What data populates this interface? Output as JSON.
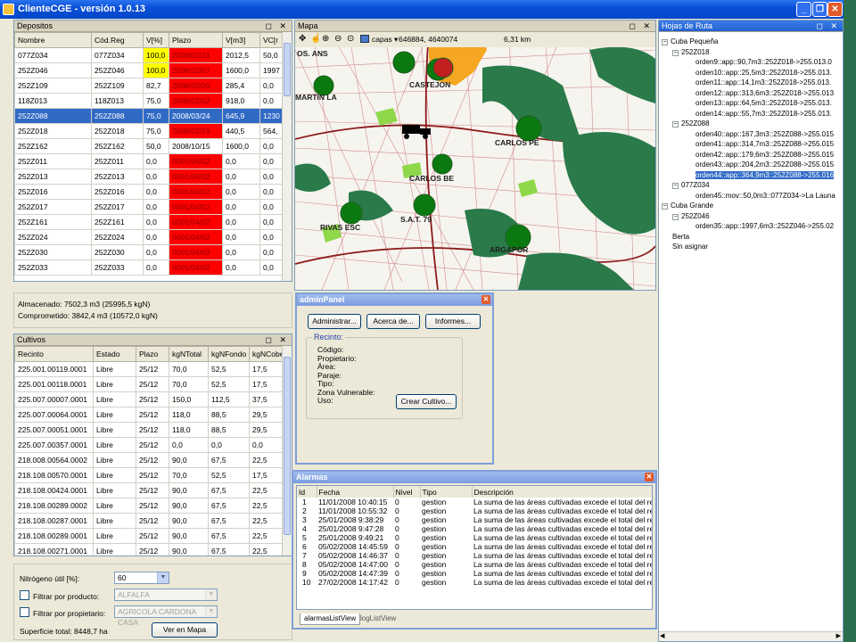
{
  "window": {
    "title": "ClienteCGE - versión 1.0.13",
    "controls": [
      "_",
      "❐",
      "✕"
    ]
  },
  "panel_buttons": "◻ ✕",
  "depositos": {
    "title": "Depositos",
    "columns": [
      "Nombre",
      "Cód.Reg",
      "V[%]",
      "Plazo",
      "V[m3]",
      "VC[r"
    ],
    "rows": [
      [
        "077Z034",
        "077Z034",
        "100,0",
        "2008/02/21",
        "2012,5",
        "50,0"
      ],
      [
        "252Z046",
        "252Z046",
        "100,0",
        "2008/02/07",
        "1600,0",
        "1997"
      ],
      [
        "252Z109",
        "252Z109",
        "82,7",
        "2008/03/20",
        "285,4",
        "0,0"
      ],
      [
        "118Z013",
        "118Z013",
        "75,0",
        "2008/02/02",
        "918,0",
        "0,0"
      ],
      [
        "252Z088",
        "252Z088",
        "75,0",
        "2008/03/24",
        "645,9",
        "1230"
      ],
      [
        "252Z018",
        "252Z018",
        "75,0",
        "2008/02/16",
        "440,5",
        "564,"
      ],
      [
        "252Z162",
        "252Z162",
        "50,0",
        "2008/10/15",
        "1600,0",
        "0,0"
      ],
      [
        "252Z011",
        "252Z011",
        "0,0",
        "0001/04/02",
        "0,0",
        "0,0"
      ],
      [
        "252Z013",
        "252Z013",
        "0,0",
        "0001/04/02",
        "0,0",
        "0,0"
      ],
      [
        "252Z016",
        "252Z016",
        "0,0",
        "0001/04/02",
        "0,0",
        "0,0"
      ],
      [
        "252Z017",
        "252Z017",
        "0,0",
        "0001/04/02",
        "0,0",
        "0,0"
      ],
      [
        "252Z161",
        "252Z161",
        "0,0",
        "0001/04/02",
        "0,0",
        "0,0"
      ],
      [
        "252Z024",
        "252Z024",
        "0,0",
        "0001/04/02",
        "0,0",
        "0,0"
      ],
      [
        "252Z030",
        "252Z030",
        "0,0",
        "0001/04/02",
        "0,0",
        "0,0"
      ],
      [
        "252Z033",
        "252Z033",
        "0,0",
        "0001/04/02",
        "0,0",
        "0,0"
      ]
    ],
    "status_colors": {
      "full": "#ffff00",
      "expired": "#ff0000",
      "selected": "#316ac5"
    },
    "almacenado": "Almacenado: 7502,3 m3 (25995,5 kgN)",
    "comprometido": "Comprometido: 3842,4 m3 (10572,0 kgN)"
  },
  "cultivos": {
    "title": "Cultivos",
    "columns": [
      "Recinto",
      "Estado",
      "Plazo",
      "kgNTotal",
      "kgNFondo",
      "kgNCober"
    ],
    "rows": [
      [
        "225.001.00119.0001",
        "Libre",
        "25/12",
        "70,0",
        "52,5",
        "17,5"
      ],
      [
        "225.001.00118.0001",
        "Libre",
        "25/12",
        "70,0",
        "52,5",
        "17,5"
      ],
      [
        "225.007.00007.0001",
        "Libre",
        "25/12",
        "150,0",
        "112,5",
        "37,5"
      ],
      [
        "225.007.00064.0001",
        "Libre",
        "25/12",
        "118,0",
        "88,5",
        "29,5"
      ],
      [
        "225.007.00051.0001",
        "Libre",
        "25/12",
        "118,0",
        "88,5",
        "29,5"
      ],
      [
        "225.007.00357.0001",
        "Libre",
        "25/12",
        "0,0",
        "0,0",
        "0,0"
      ],
      [
        "218.008.00564.0002",
        "Libre",
        "25/12",
        "90,0",
        "67,5",
        "22,5"
      ],
      [
        "218.108.00570.0001",
        "Libre",
        "25/12",
        "70,0",
        "52,5",
        "17,5"
      ],
      [
        "218.108.00424.0001",
        "Libre",
        "25/12",
        "90,0",
        "67,5",
        "22,5"
      ],
      [
        "218.108.00289.0002",
        "Libre",
        "25/12",
        "90,0",
        "67,5",
        "22,5"
      ],
      [
        "218.108.00287.0001",
        "Libre",
        "25/12",
        "90,0",
        "67,5",
        "22,5"
      ],
      [
        "218.108.00289.0001",
        "Libre",
        "25/12",
        "90,0",
        "67,5",
        "22,5"
      ],
      [
        "218.108.00271.0001",
        "Libre",
        "25/12",
        "90,0",
        "67,5",
        "22,5"
      ]
    ],
    "nitrogeno_label": "Nitrógeno útil [%]:",
    "nitrogeno_value": "60",
    "filtrar_producto_label": "Filtrar por producto:",
    "filtrar_producto_value": "ALFALFA",
    "filtrar_propietario_label": "Filtrar por propietario:",
    "filtrar_propietario_value": "AGRICOLA CARDONA CASA",
    "superficie": "Superficie total: 8448,7 ha",
    "ver_mapa": "Ver en Mapa"
  },
  "mapa": {
    "title": "Mapa",
    "capas_label": "capas",
    "coords": "646884, 4640074",
    "scale": "6,31 km",
    "labels": [
      "OS. ANS",
      "CASTEJON",
      "MARTIN LA",
      "CARLOS PE",
      "CARLOS BE",
      "S.A.T. 79",
      "RIVAS ESC",
      "ARGAPOR"
    ]
  },
  "hojas": {
    "title": "Hojas de Ruta",
    "tree": [
      {
        "level": 0,
        "box": "−",
        "text": "Cuba Pequeña"
      },
      {
        "level": 1,
        "box": "−",
        "text": "252Z018"
      },
      {
        "level": 2,
        "text": "orden9::app::90,7m3::252Z018->255.013.0"
      },
      {
        "level": 2,
        "text": "orden10::app::25,5m3::252Z018->255.013."
      },
      {
        "level": 2,
        "text": "orden11::app::14,1m3::252Z018->255.013."
      },
      {
        "level": 2,
        "text": "orden12::app::313,6m3::252Z018->255.013"
      },
      {
        "level": 2,
        "text": "orden13::app::64,5m3::252Z018->255.013."
      },
      {
        "level": 2,
        "text": "orden14::app::55,7m3::252Z018->255.013."
      },
      {
        "level": 1,
        "box": "−",
        "text": "252Z088"
      },
      {
        "level": 2,
        "text": "orden40::app::167,3m3::252Z088->255.015"
      },
      {
        "level": 2,
        "text": "orden41::app::314,7m3::252Z088->255.015"
      },
      {
        "level": 2,
        "text": "orden42::app::179,6m3::252Z088->255.015"
      },
      {
        "level": 2,
        "text": "orden43::app::204,2m3::252Z088->255.015"
      },
      {
        "level": 2,
        "text": "orden44::app::364,9m3::252Z088->255.016",
        "selected": true
      },
      {
        "level": 1,
        "box": "−",
        "text": "077Z034"
      },
      {
        "level": 2,
        "text": "orden45::mov::50,0m3::077Z034->La Launa"
      },
      {
        "level": 0,
        "box": "−",
        "text": "Cuba Grande"
      },
      {
        "level": 1,
        "box": "−",
        "text": "252Z046"
      },
      {
        "level": 2,
        "text": "orden35::app::1997,6m3::252Z046->255.02"
      },
      {
        "level": 0,
        "text": "Berta"
      },
      {
        "level": 0,
        "text": "Sin asignar"
      }
    ]
  },
  "admin": {
    "title": "adminPanel",
    "buttons": [
      "Administrar...",
      "Acerca de...",
      "Informes..."
    ],
    "group_title": "Recinto:",
    "fields": [
      "Código:",
      "Propietario:",
      "Área:",
      "Paraje:",
      "Tipo:",
      "Zona Vulnerable:",
      "Uso:"
    ],
    "crear": "Crear Cultivo..."
  },
  "alarmas": {
    "title": "Alarmas",
    "columns": [
      "Id",
      "Fecha",
      "Nivel",
      "Tipo",
      "Descripción"
    ],
    "rows": [
      [
        "1",
        "11/01/2008 10:40:15",
        "0",
        "gestion",
        "La suma de las áreas cultivadas excede el total del recinto"
      ],
      [
        "2",
        "11/01/2008 10:55:32",
        "0",
        "gestion",
        "La suma de las áreas cultivadas excede el total del recinto"
      ],
      [
        "3",
        "25/01/2008 9:38:29",
        "0",
        "gestion",
        "La suma de las áreas cultivadas excede el total del recinto"
      ],
      [
        "4",
        "25/01/2008 9:47:28",
        "0",
        "gestion",
        "La suma de las áreas cultivadas excede el total del recinto"
      ],
      [
        "5",
        "25/01/2008 9:49:21",
        "0",
        "gestion",
        "La suma de las áreas cultivadas excede el total del recinto"
      ],
      [
        "6",
        "05/02/2008 14:45:59",
        "0",
        "gestion",
        "La suma de las áreas cultivadas excede el total del recinto"
      ],
      [
        "7",
        "05/02/2008 14:46:37",
        "0",
        "gestion",
        "La suma de las áreas cultivadas excede el total del recinto"
      ],
      [
        "8",
        "05/02/2008 14:47:00",
        "0",
        "gestion",
        "La suma de las áreas cultivadas excede el total del recinto"
      ],
      [
        "9",
        "05/02/2008 14:47:39",
        "0",
        "gestion",
        "La suma de las áreas cultivadas excede el total del recinto"
      ],
      [
        "10",
        "27/02/2008 14:17:42",
        "0",
        "gestion",
        "La suma de las áreas cultivadas excede el total del recinto"
      ]
    ],
    "tabs": [
      "alarmasListView",
      "logListView"
    ]
  }
}
